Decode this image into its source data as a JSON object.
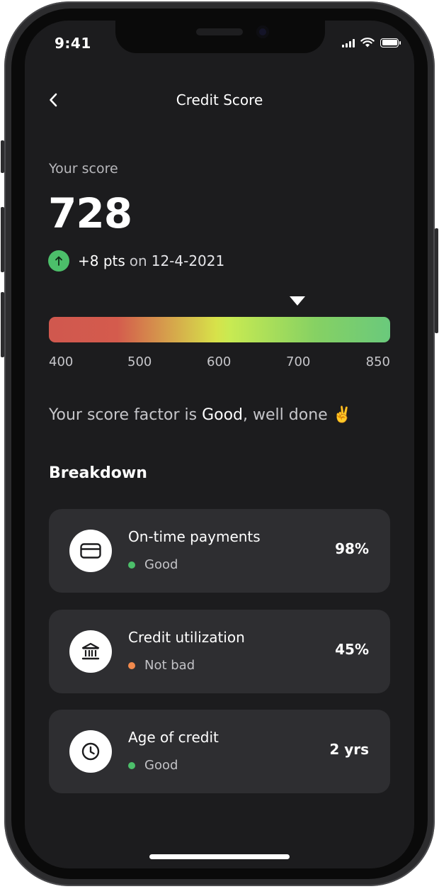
{
  "status_bar": {
    "time": "9:41"
  },
  "nav": {
    "title": "Credit Score"
  },
  "score": {
    "label": "Your score",
    "value": "728",
    "delta": "+8 pts",
    "delta_conj": "on",
    "delta_date": "12-4-2021"
  },
  "scale": {
    "ticks": [
      "400",
      "500",
      "600",
      "700",
      "850"
    ],
    "min": 400,
    "max": 850,
    "current": 728
  },
  "factor": {
    "prefix": "Your score factor is ",
    "rating": "Good",
    "suffix": ", well done ",
    "emoji": "✌️"
  },
  "breakdown": {
    "title": "Breakdown",
    "items": [
      {
        "title": "On-time payments",
        "status": "Good",
        "value": "98%",
        "icon": "credit-card-icon",
        "status_color": "#4cbf6a"
      },
      {
        "title": "Credit utilization",
        "status": "Not bad",
        "value": "45%",
        "icon": "bank-icon",
        "status_color": "#f28a4d"
      },
      {
        "title": "Age of credit",
        "status": "Good",
        "value": "2 yrs",
        "icon": "clock-icon",
        "status_color": "#4cbf6a"
      }
    ]
  },
  "colors": {
    "background": "#1c1c1e",
    "card": "#2e2e31",
    "positive": "#4cbf6a",
    "warning": "#f28a4d"
  }
}
